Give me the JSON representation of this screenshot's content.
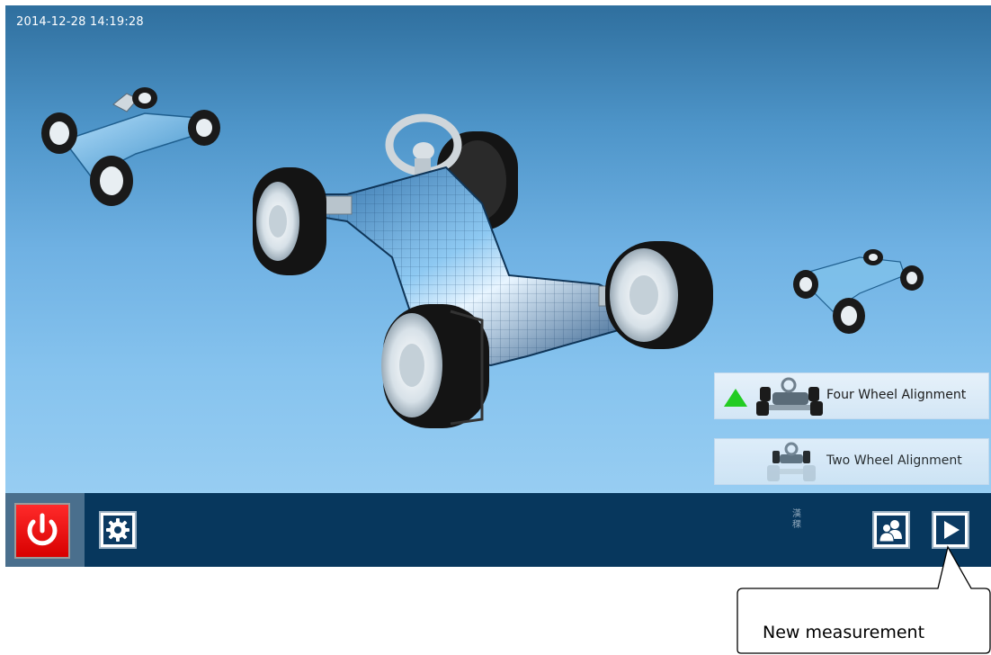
{
  "status": {
    "datetime": "2014-12-28 14:19:28"
  },
  "modes": {
    "four_wheel": {
      "label": "Four Wheel Alignment",
      "selected": true
    },
    "two_wheel": {
      "label": "Two Wheel Alignment",
      "selected": false
    }
  },
  "toolbar": {
    "language_glyph_top": "漢",
    "language_glyph_bottom": "稞"
  },
  "annotation": {
    "callout_text": "New measurement"
  },
  "colors": {
    "power_red": "#e00000",
    "toolbar_bg": "#07375d",
    "selected_indicator": "#22cc22"
  },
  "icons": {
    "power": "power-icon",
    "settings": "gear-icon",
    "users": "users-icon",
    "next": "play-icon",
    "selected": "triangle-up-icon"
  }
}
